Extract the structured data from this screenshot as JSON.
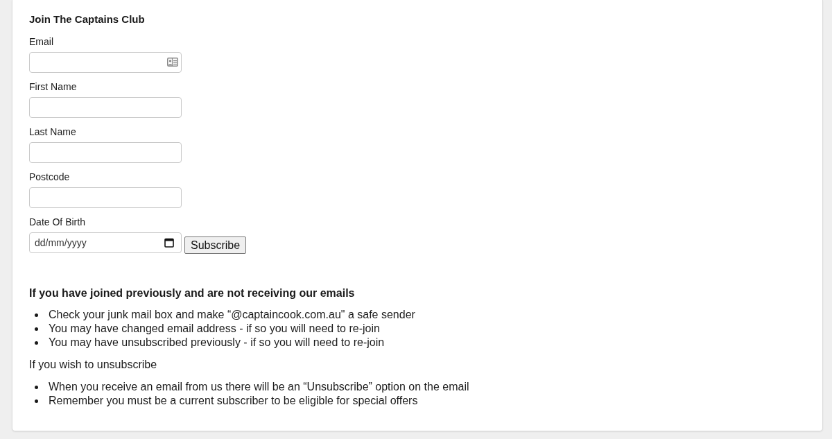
{
  "form": {
    "title": "Join The Captains Club",
    "fields": [
      {
        "label": "Email",
        "kind": "email"
      },
      {
        "label": "First Name",
        "kind": "text"
      },
      {
        "label": "Last Name",
        "kind": "text"
      },
      {
        "label": "Postcode",
        "kind": "text"
      },
      {
        "label": "Date Of Birth",
        "kind": "date",
        "placeholder": "dd/mm/yyyy"
      }
    ],
    "submit": "Subscribe"
  },
  "help": {
    "heading": "If you have joined previously and are not receiving our emails",
    "items": [
      "Check your junk mail box and make “@captaincook.com.au\" a safe sender",
      "You may have changed email address - if so you will need to re-join",
      "You may have unsubscribed previously - if so you will need to re-join"
    ],
    "subheading": "If you wish to unsubscribe",
    "unsubscribe_items": [
      "When you receive an email from us there will be an “Unsubscribe” option on the email",
      "Remember you must be a current subscriber to be eligible for special offers"
    ]
  }
}
